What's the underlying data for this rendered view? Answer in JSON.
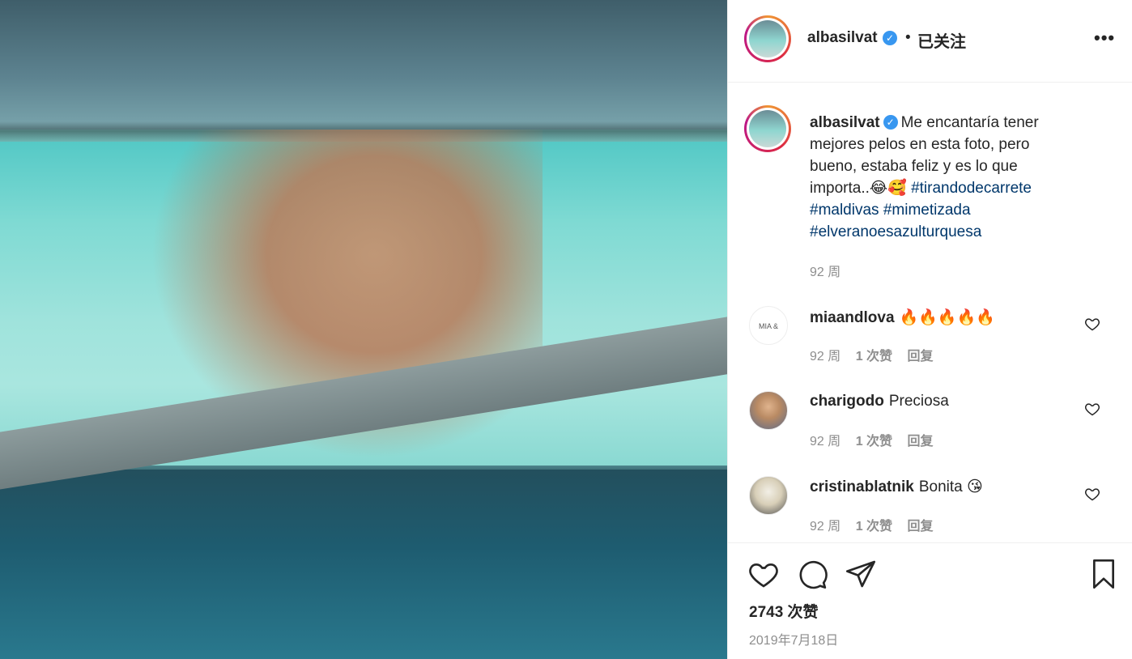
{
  "post": {
    "username": "albasilvat",
    "follow_state": "已关注",
    "more_label": "•••",
    "dot": "•",
    "verified_mark": "✓",
    "caption": {
      "text": "Me encantaría tener mejores pelos en esta foto, pero bueno, estaba feliz y es lo que importa..😂🥰",
      "hashtags": [
        "#tirandodecarrete",
        "#maldivas",
        "#mimetizada",
        "#elveranoesazulturquesa"
      ]
    },
    "caption_age": "92 周",
    "likes": "2743 次赞",
    "date": "2019年7月18日"
  },
  "comments": [
    {
      "username": "miaandlova",
      "text": "🔥🔥🔥🔥🔥",
      "avatar_text": "MIA & LOVA",
      "age": "92 周",
      "likes": "1 次赞",
      "reply": "回复"
    },
    {
      "username": "charigodo",
      "text": "Preciosa",
      "age": "92 周",
      "likes": "1 次赞",
      "reply": "回复"
    },
    {
      "username": "cristinablatnik",
      "text": "Bonita 😘",
      "age": "92 周",
      "likes": "1 次赞",
      "reply": "回复"
    }
  ],
  "icons": {
    "like": "heart-icon",
    "comment": "comment-icon",
    "share": "share-icon",
    "save": "bookmark-icon",
    "more": "more-horizontal-icon"
  },
  "colors": {
    "hashtag": "#00376b",
    "verified": "#3897f0",
    "muted": "#8e8e8e",
    "text": "#262626"
  }
}
